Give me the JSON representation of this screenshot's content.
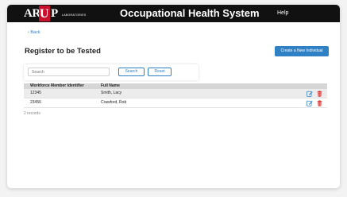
{
  "header": {
    "logo_text_left": "AR",
    "logo_text_mark": "U",
    "logo_text_right": "P",
    "logo_subtext": "LABORATORIES",
    "app_title": "Occupational Health System",
    "help_label": "Help"
  },
  "nav": {
    "back_label": "‹  Back"
  },
  "page": {
    "title": "Register to be Tested",
    "create_button_label": "Create a New Individual"
  },
  "search": {
    "placeholder": "Search",
    "value": "",
    "search_button_label": "Search",
    "reset_button_label": "Reset"
  },
  "table": {
    "columns": [
      "Workforce Member Identifier",
      "Full Name"
    ],
    "rows": [
      {
        "id": "12345",
        "name": "Smith, Lacy"
      },
      {
        "id": "23456",
        "name": "Crawford, Rob"
      }
    ],
    "record_count_label": "2 records"
  },
  "colors": {
    "accent": "#2f80c4",
    "danger": "#d32f2f",
    "topbar": "#111111",
    "logo_mark": "#c8102e"
  },
  "icons": {
    "edit": "edit-icon",
    "delete": "trash-icon"
  }
}
